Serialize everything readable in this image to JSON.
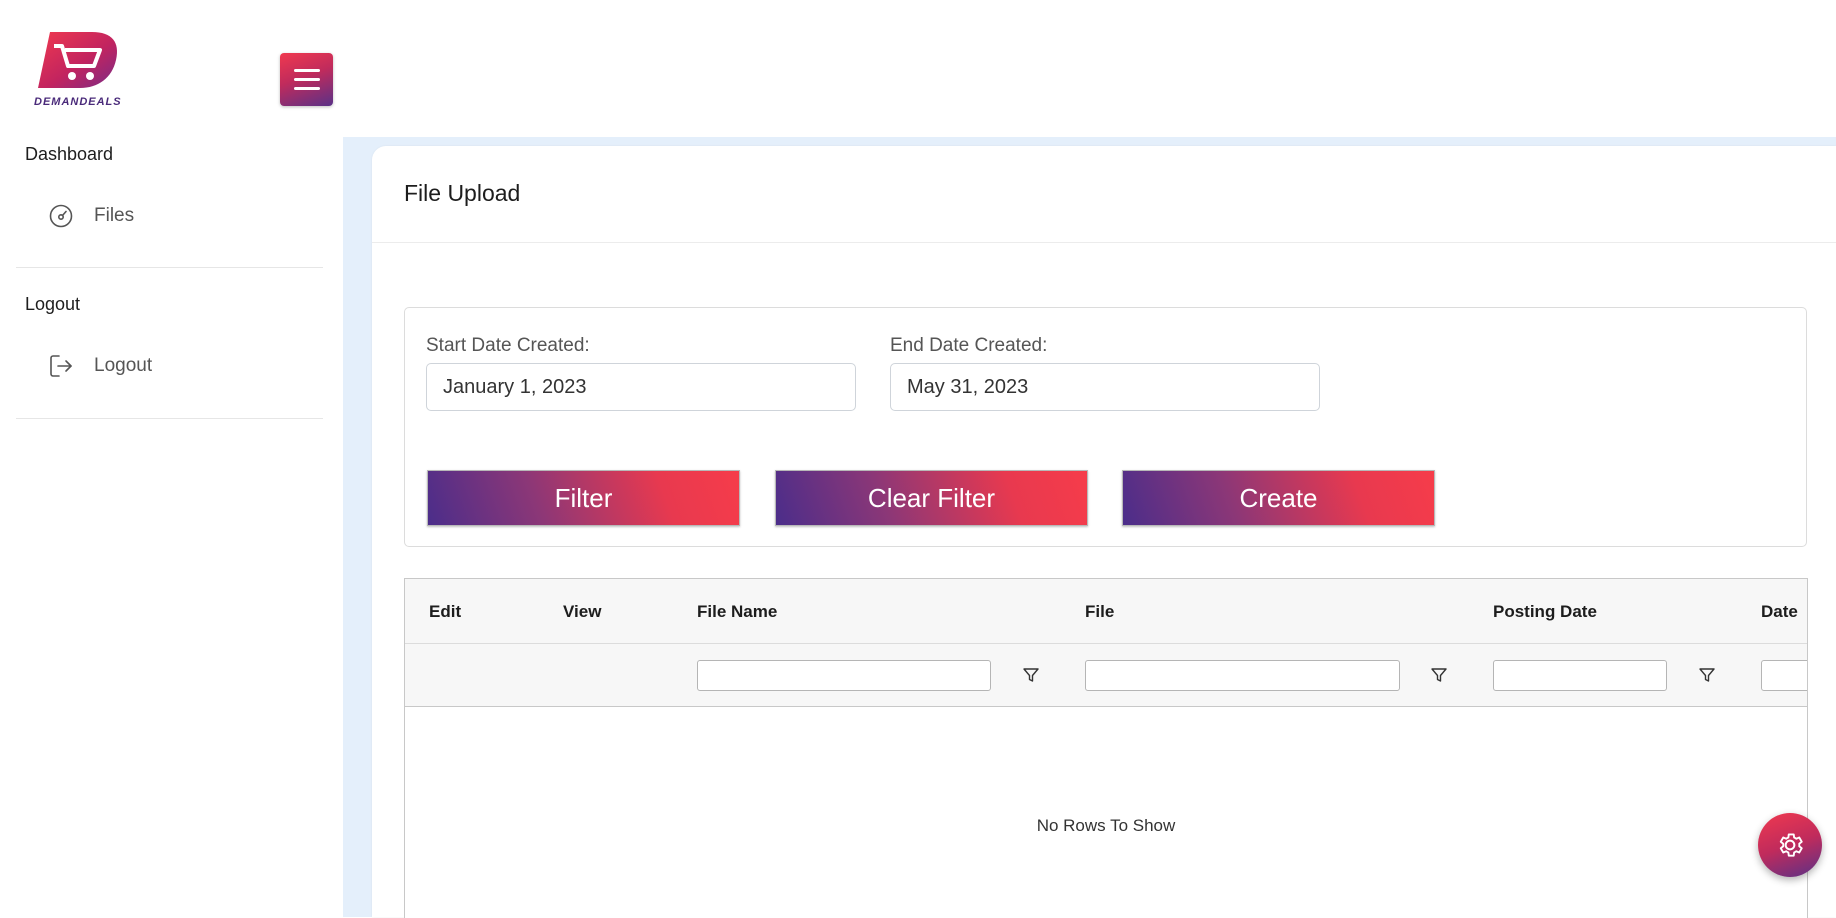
{
  "brand": {
    "name": "DEMANDEALS"
  },
  "sidebar": {
    "sections": [
      {
        "title": "Dashboard",
        "items": [
          {
            "label": "Files",
            "icon": "gauge-icon"
          }
        ]
      },
      {
        "title": "Logout",
        "items": [
          {
            "label": "Logout",
            "icon": "logout-icon"
          }
        ]
      }
    ]
  },
  "page": {
    "title": "File Upload"
  },
  "filters": {
    "start_label": "Start Date Created:",
    "start_value": "January 1, 2023",
    "end_label": "End Date Created:",
    "end_value": "May 31, 2023",
    "buttons": {
      "filter": "Filter",
      "clear": "Clear Filter",
      "create": "Create"
    }
  },
  "grid": {
    "columns": [
      "Edit",
      "View",
      "File Name",
      "File",
      "Posting Date",
      "Date"
    ],
    "filterable_columns": [
      "File Name",
      "File",
      "Posting Date",
      "Date"
    ],
    "empty_text": "No Rows To Show"
  },
  "colors": {
    "gradient_start": "#4b2d8a",
    "gradient_end": "#f63c4a",
    "content_background": "#e4effb"
  },
  "icons": {
    "menu": "hamburger-icon",
    "filter": "funnel-icon",
    "settings": "gear-icon"
  }
}
